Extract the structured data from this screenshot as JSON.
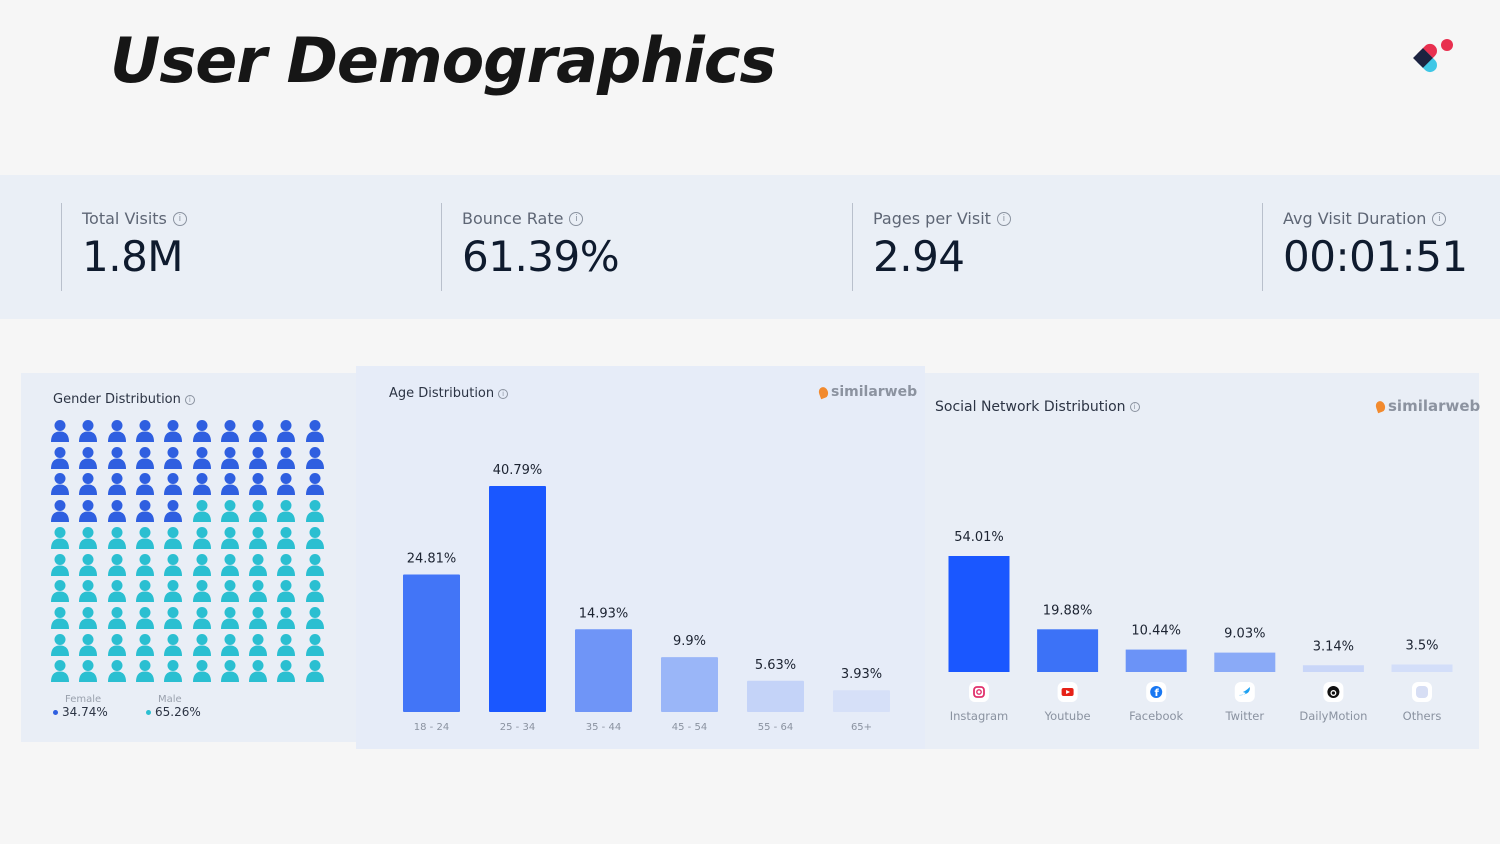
{
  "page": {
    "title": "User Demographics"
  },
  "stats": [
    {
      "label": "Total Visits",
      "value": "1.8M"
    },
    {
      "label": "Bounce Rate",
      "value": "61.39%"
    },
    {
      "label": "Pages per Visit",
      "value": "2.94"
    },
    {
      "label": "Avg Visit Duration",
      "value": "00:01:51"
    }
  ],
  "gender": {
    "title": "Gender Distribution",
    "female": {
      "label": "Female",
      "value": "34.74%",
      "color": "#2f5fe0"
    },
    "male": {
      "label": "Male",
      "value": "65.26%",
      "color": "#2bbfd1"
    }
  },
  "age": {
    "title": "Age Distribution",
    "brand": "similarweb"
  },
  "social": {
    "title": "Social Network Distribution",
    "brand": "similarweb"
  },
  "colors": {
    "accent": "#1a57ff",
    "female": "#2f5fe0",
    "male": "#2bbfd1"
  },
  "chart_data": [
    {
      "type": "bar",
      "title": "Age Distribution",
      "categories": [
        "18 - 24",
        "25 - 34",
        "35 - 44",
        "45 - 54",
        "55 - 64",
        "65+"
      ],
      "values": [
        24.81,
        40.79,
        14.93,
        9.9,
        5.63,
        3.93
      ],
      "labels": [
        "24.81%",
        "40.79%",
        "14.93%",
        "9.9%",
        "5.63%",
        "3.93%"
      ],
      "colors": [
        "#4275f7",
        "#1a57ff",
        "#6f95f7",
        "#9ab6f8",
        "#c4d3f8",
        "#d6e0f8"
      ],
      "ylim": [
        0,
        40.79
      ]
    },
    {
      "type": "bar",
      "title": "Social Network Distribution",
      "categories": [
        "Instagram",
        "Youtube",
        "Facebook",
        "Twitter",
        "DailyMotion",
        "Others"
      ],
      "values": [
        54.01,
        19.88,
        10.44,
        9.03,
        3.14,
        3.5
      ],
      "labels": [
        "54.01%",
        "19.88%",
        "10.44%",
        "9.03%",
        "3.14%",
        "3.5%"
      ],
      "icons": [
        "instagram-icon",
        "youtube-icon",
        "facebook-icon",
        "twitter-icon",
        "dailymotion-icon",
        "others-icon"
      ],
      "colors": [
        "#1a57ff",
        "#3c72f7",
        "#6b93f7",
        "#8aaaf7",
        "#c9d6f8",
        "#d3def9"
      ],
      "ylim": [
        0,
        54.01
      ]
    }
  ]
}
